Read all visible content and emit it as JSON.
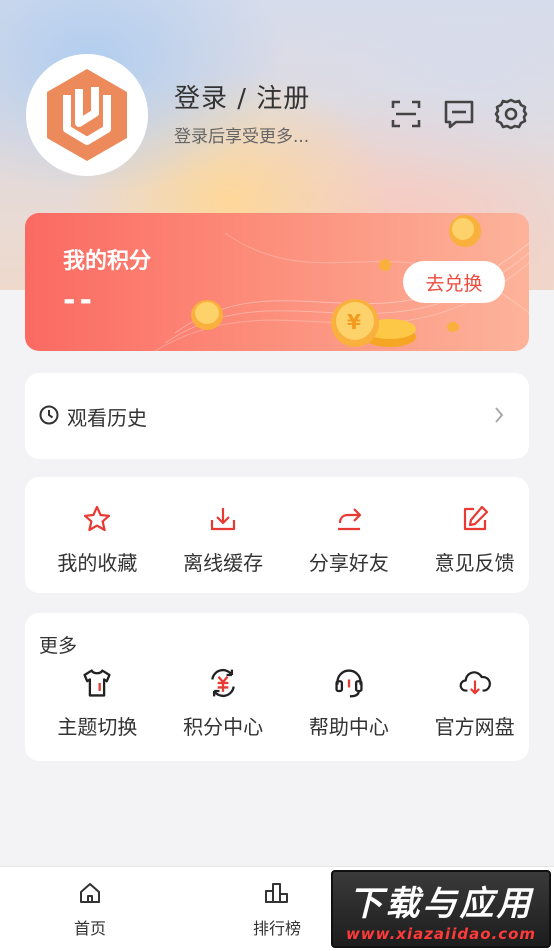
{
  "header": {
    "login_title": "登录 / 注册",
    "login_subtitle": "登录后享受更多...",
    "icons": [
      "scan-icon",
      "message-icon",
      "settings-icon"
    ]
  },
  "points": {
    "title": "我的积分",
    "value": "--",
    "redeem_label": "去兑换"
  },
  "history": {
    "label": "观看历史"
  },
  "quick_actions": [
    {
      "label": "我的收藏",
      "icon": "star-icon"
    },
    {
      "label": "离线缓存",
      "icon": "download-icon"
    },
    {
      "label": "分享好友",
      "icon": "share-icon"
    },
    {
      "label": "意见反馈",
      "icon": "edit-icon"
    }
  ],
  "more": {
    "title": "更多",
    "items": [
      {
        "label": "主题切换",
        "icon": "tshirt-icon"
      },
      {
        "label": "积分中心",
        "icon": "yuan-exchange-icon"
      },
      {
        "label": "帮助中心",
        "icon": "headset-icon"
      },
      {
        "label": "官方网盘",
        "icon": "cloud-download-icon"
      }
    ]
  },
  "tabs": [
    {
      "label": "首页",
      "icon": "home-icon"
    },
    {
      "label": "排行榜",
      "icon": "chart-icon"
    }
  ],
  "watermark": {
    "title": "下载与应用",
    "url": "www.xiazaiidao.com"
  },
  "colors": {
    "accent": "#f04a3e",
    "card_gradient_start": "#fb6a62",
    "card_gradient_end": "#fdb39a",
    "avatar_logo": "#ec8a5c"
  }
}
